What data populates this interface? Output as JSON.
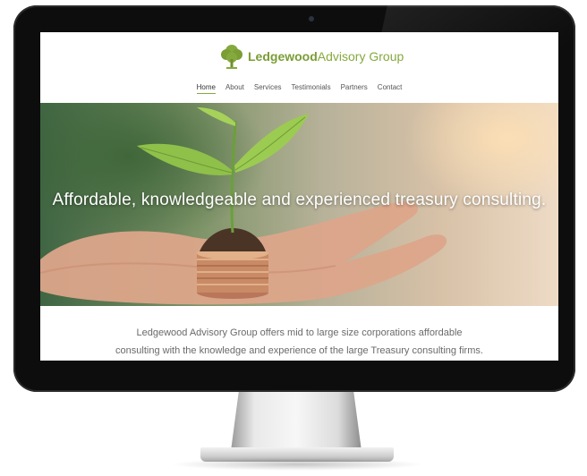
{
  "site": {
    "brand_bold": "Ledgewood",
    "brand_rest": "Advisory Group",
    "brand_color": "#86a93e"
  },
  "nav": {
    "items": [
      {
        "label": "Home",
        "active": true
      },
      {
        "label": "About"
      },
      {
        "label": "Services"
      },
      {
        "label": "Testimonials"
      },
      {
        "label": "Partners"
      },
      {
        "label": "Contact"
      }
    ]
  },
  "hero": {
    "headline": "Affordable, knowledgeable and experienced treasury consulting.",
    "image_icon": "seedling-on-coins-in-hand"
  },
  "intro": {
    "line1": "Ledgewood Advisory Group offers mid to large size corporations affordable",
    "line2": "consulting with the knowledge and experience of the large Treasury consulting firms."
  },
  "icons": {
    "logo": "tree-icon"
  }
}
